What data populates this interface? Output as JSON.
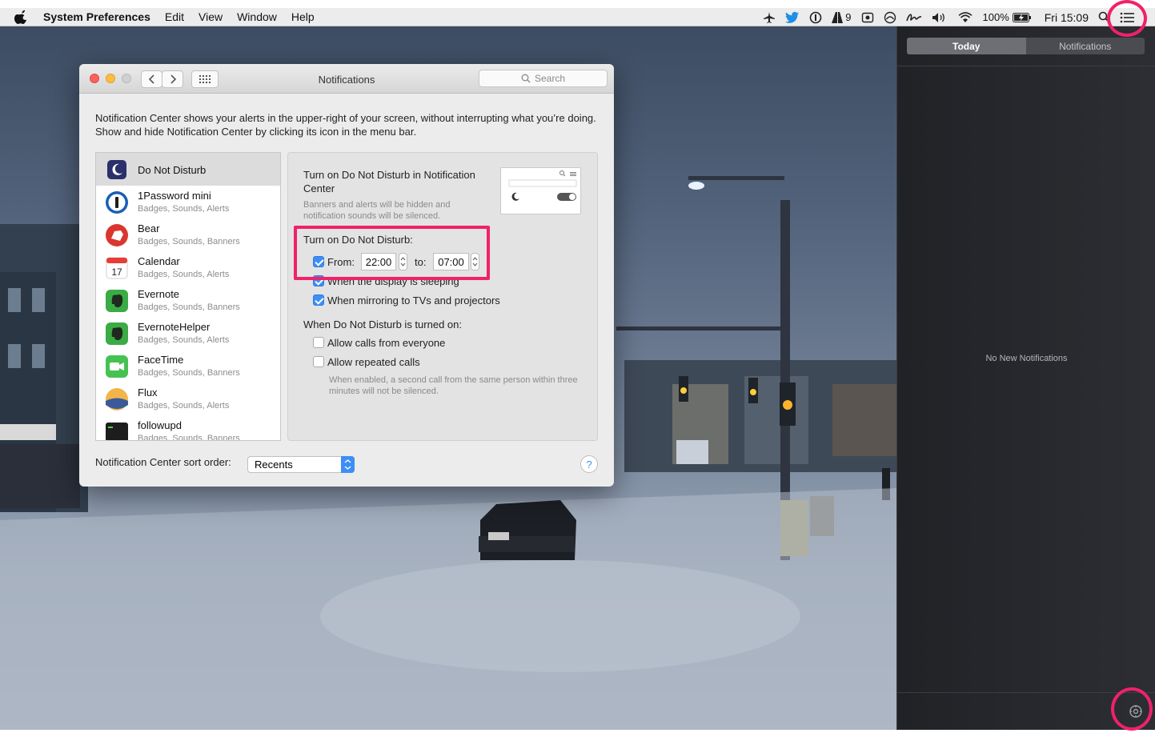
{
  "menubar": {
    "app_name": "System Preferences",
    "menus": [
      "Edit",
      "View",
      "Window",
      "Help"
    ],
    "badge_count": "9",
    "battery": "100%",
    "clock": "Fri 15:09"
  },
  "window": {
    "title": "Notifications",
    "search_placeholder": "Search",
    "description": "Notification Center shows your alerts in the upper-right of your screen, without interrupting what you’re doing. Show and hide Notification Center by clicking its icon in the menu bar."
  },
  "apps": [
    {
      "name": "Do Not Disturb",
      "sub": "",
      "icon": "moon-icon",
      "color": "#2b2f6a"
    },
    {
      "name": "1Password mini",
      "sub": "Badges, Sounds, Alerts",
      "icon": "1password-icon",
      "color": "#1a5fb4"
    },
    {
      "name": "Bear",
      "sub": "Badges, Sounds, Banners",
      "icon": "bear-icon",
      "color": "#d9362f"
    },
    {
      "name": "Calendar",
      "sub": "Badges, Sounds, Alerts",
      "icon": "calendar-icon",
      "color": "#ffffff"
    },
    {
      "name": "Evernote",
      "sub": "Badges, Sounds, Banners",
      "icon": "evernote-icon",
      "color": "#3bab45"
    },
    {
      "name": "EvernoteHelper",
      "sub": "Badges, Sounds, Alerts",
      "icon": "evernote-helper-icon",
      "color": "#3bab45"
    },
    {
      "name": "FaceTime",
      "sub": "Badges, Sounds, Banners",
      "icon": "facetime-icon",
      "color": "#46c253"
    },
    {
      "name": "Flux",
      "sub": "Badges, Sounds, Alerts",
      "icon": "flux-icon",
      "color": "#f3b54a"
    },
    {
      "name": "followupd",
      "sub": "Badges, Sounds, Banners",
      "icon": "terminal-icon",
      "color": "#1d1d1d"
    }
  ],
  "pane": {
    "nc_heading": "Turn on Do Not Disturb in Notification Center",
    "nc_sub": "Banners and alerts will be hidden and notification sounds will be silenced.",
    "schedule_heading": "Turn on Do Not Disturb:",
    "from_label": "From:",
    "from_value": "22:00",
    "to_label": "to:",
    "to_value": "07:00",
    "display_sleep_label": "When the display is sleeping",
    "mirroring_label": "When mirroring to TVs and projectors",
    "when_on_heading": "When Do Not Disturb is turned on:",
    "allow_calls_label": "Allow calls from everyone",
    "repeated_calls_label": "Allow repeated calls",
    "repeated_note": "When enabled, a second call from the same person within three minutes will not be silenced."
  },
  "sort": {
    "label": "Notification Center sort order:",
    "value": "Recents",
    "help": "?"
  },
  "notification_center": {
    "tab_today": "Today",
    "tab_notifications": "Notifications",
    "empty": "No New Notifications"
  },
  "colors": {
    "highlight": "#f0216a",
    "accent": "#3d8ef7"
  }
}
